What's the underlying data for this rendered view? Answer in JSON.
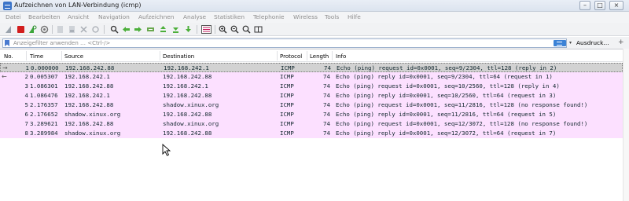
{
  "window": {
    "title": "Aufzeichnen von LAN-Verbindung (icmp)",
    "minimize_glyph": "–",
    "maximize_glyph": "□",
    "close_glyph": "×"
  },
  "menu": {
    "items": [
      "Datei",
      "Bearbeiten",
      "Ansicht",
      "Navigation",
      "Aufzeichnen",
      "Analyse",
      "Statistiken",
      "Telephonie",
      "Wireless",
      "Tools",
      "Hilfe"
    ]
  },
  "toolbar": {
    "icons": [
      "shark-fin-start-icon",
      "stop-capture-icon",
      "restart-capture-icon",
      "capture-options-icon",
      "open-file-icon",
      "save-file-icon",
      "close-file-icon",
      "reload-file-icon",
      "find-packet-icon",
      "go-back-icon",
      "go-forward-icon",
      "go-to-packet-icon",
      "go-first-packet-icon",
      "go-last-packet-icon",
      "auto-scroll-icon",
      "colorize-icon",
      "zoom-in-icon",
      "zoom-out-icon",
      "zoom-normal-icon",
      "resize-columns-icon"
    ]
  },
  "filter": {
    "placeholder": "Anzeigefilter anwenden … <Ctrl-/>",
    "value": "",
    "expression_label": "Ausdruck…",
    "plus_glyph": "+"
  },
  "packet_list": {
    "columns": [
      "No.",
      "Time",
      "Source",
      "Destination",
      "Protocol",
      "Length",
      "Info"
    ],
    "rows": [
      {
        "no": "1",
        "time": "0.000000",
        "source": "192.168.242.88",
        "destination": "192.168.242.1",
        "protocol": "ICMP",
        "length": "74",
        "info": "Echo (ping) request  id=0x0001, seq=9/2304, ttl=128 (reply in 2)",
        "arrow": "→",
        "selected": true
      },
      {
        "no": "2",
        "time": "0.005307",
        "source": "192.168.242.1",
        "destination": "192.168.242.88",
        "protocol": "ICMP",
        "length": "74",
        "info": "Echo (ping) reply    id=0x0001, seq=9/2304, ttl=64 (request in 1)",
        "arrow": "←",
        "selected": false
      },
      {
        "no": "3",
        "time": "1.086301",
        "source": "192.168.242.88",
        "destination": "192.168.242.1",
        "protocol": "ICMP",
        "length": "74",
        "info": "Echo (ping) request  id=0x0001, seq=10/2560, ttl=128 (reply in 4)",
        "arrow": "",
        "selected": false
      },
      {
        "no": "4",
        "time": "1.086476",
        "source": "192.168.242.1",
        "destination": "192.168.242.88",
        "protocol": "ICMP",
        "length": "74",
        "info": "Echo (ping) reply    id=0x0001, seq=10/2560, ttl=64 (request in 3)",
        "arrow": "",
        "selected": false
      },
      {
        "no": "5",
        "time": "2.176357",
        "source": "192.168.242.88",
        "destination": "shadow.xinux.org",
        "protocol": "ICMP",
        "length": "74",
        "info": "Echo (ping) request  id=0x0001, seq=11/2816, ttl=128 (no response found!)",
        "arrow": "",
        "selected": false
      },
      {
        "no": "6",
        "time": "2.176652",
        "source": "shadow.xinux.org",
        "destination": "192.168.242.88",
        "protocol": "ICMP",
        "length": "74",
        "info": "Echo (ping) reply    id=0x0001, seq=11/2816, ttl=64 (request in 5)",
        "arrow": "",
        "selected": false
      },
      {
        "no": "7",
        "time": "3.289621",
        "source": "192.168.242.88",
        "destination": "shadow.xinux.org",
        "protocol": "ICMP",
        "length": "74",
        "info": "Echo (ping) request  id=0x0001, seq=12/3072, ttl=128 (no response found!)",
        "arrow": "",
        "selected": false
      },
      {
        "no": "8",
        "time": "3.289984",
        "source": "shadow.xinux.org",
        "destination": "192.168.242.88",
        "protocol": "ICMP",
        "length": "74",
        "info": "Echo (ping) reply    id=0x0001, seq=12/3072, ttl=64 (request in 7)",
        "arrow": "",
        "selected": false
      }
    ]
  },
  "colors": {
    "row_icmp": "#fce0ff",
    "row_selected": "#d2d2d2",
    "row_text": "#12272e"
  }
}
